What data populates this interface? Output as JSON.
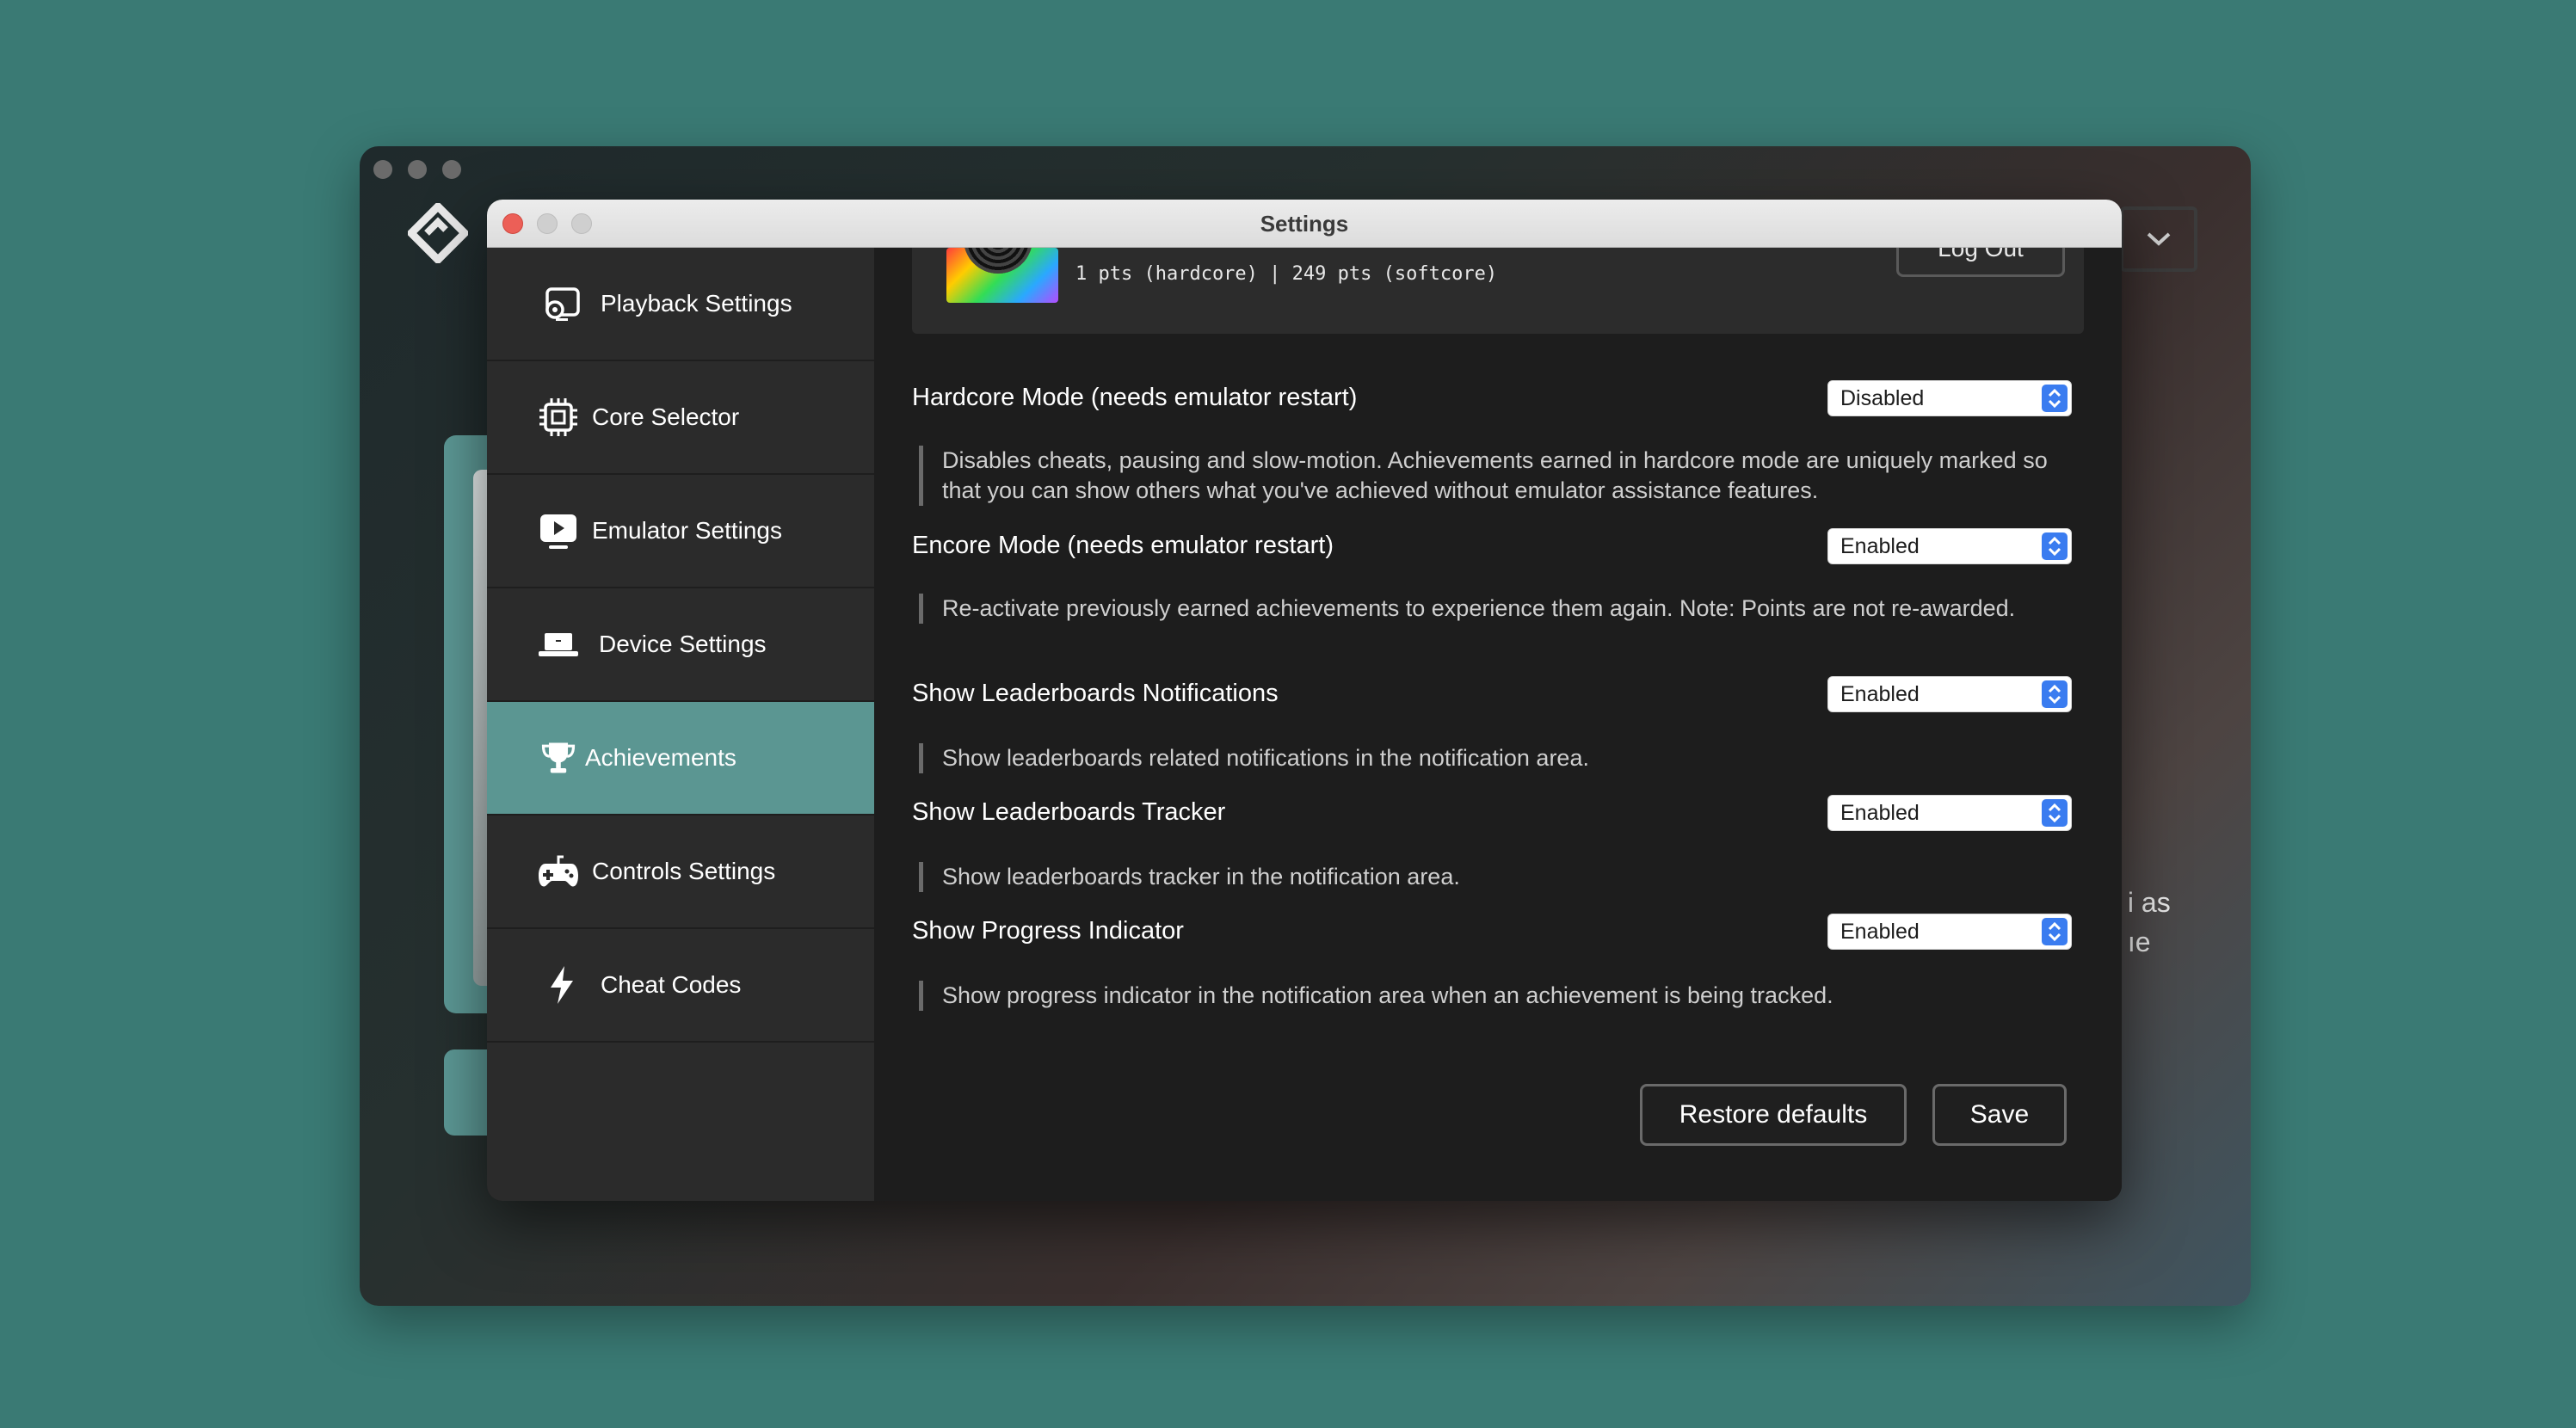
{
  "background_app": {
    "partial_text": " i as\n ıe"
  },
  "dialog": {
    "title": "Settings"
  },
  "sidebar": {
    "items": [
      {
        "label": "Playback Settings",
        "icon": "gear-screen-icon"
      },
      {
        "label": "Core Selector",
        "icon": "chip-icon"
      },
      {
        "label": "Emulator Settings",
        "icon": "play-screen-icon"
      },
      {
        "label": "Device Settings",
        "icon": "laptop-icon"
      },
      {
        "label": "Achievements",
        "icon": "trophy-icon",
        "active": true
      },
      {
        "label": "Controls Settings",
        "icon": "gamepad-icon"
      },
      {
        "label": "Cheat Codes",
        "icon": "lightning-icon"
      }
    ]
  },
  "account": {
    "points": "1 pts (hardcore) | 249 pts (softcore)",
    "logout_label": "Log Out"
  },
  "settings": [
    {
      "label": "Hardcore Mode (needs emulator restart)",
      "value": "Disabled",
      "description": "Disables cheats, pausing and slow-motion. Achievements earned in hardcore mode are uniquely marked so that you can show others what you've achieved without emulator assistance features."
    },
    {
      "label": "Encore Mode (needs emulator restart)",
      "value": "Enabled",
      "description": "Re-activate previously earned achievements to experience them again. Note: Points are not re-awarded."
    },
    {
      "label": "Show Leaderboards Notifications",
      "value": "Enabled",
      "description": "Show leaderboards related notifications in the notification area."
    },
    {
      "label": "Show Leaderboards Tracker",
      "value": "Enabled",
      "description": "Show leaderboards tracker in the notification area."
    },
    {
      "label": "Show Progress Indicator",
      "value": "Enabled",
      "description": "Show progress indicator in the notification area when an achievement is being tracked."
    }
  ],
  "buttons": {
    "restore_label": "Restore defaults",
    "save_label": "Save"
  },
  "colors": {
    "accent": "#5b9692",
    "select_chevron": "#3a7cf0",
    "close": "#ec5f57"
  }
}
